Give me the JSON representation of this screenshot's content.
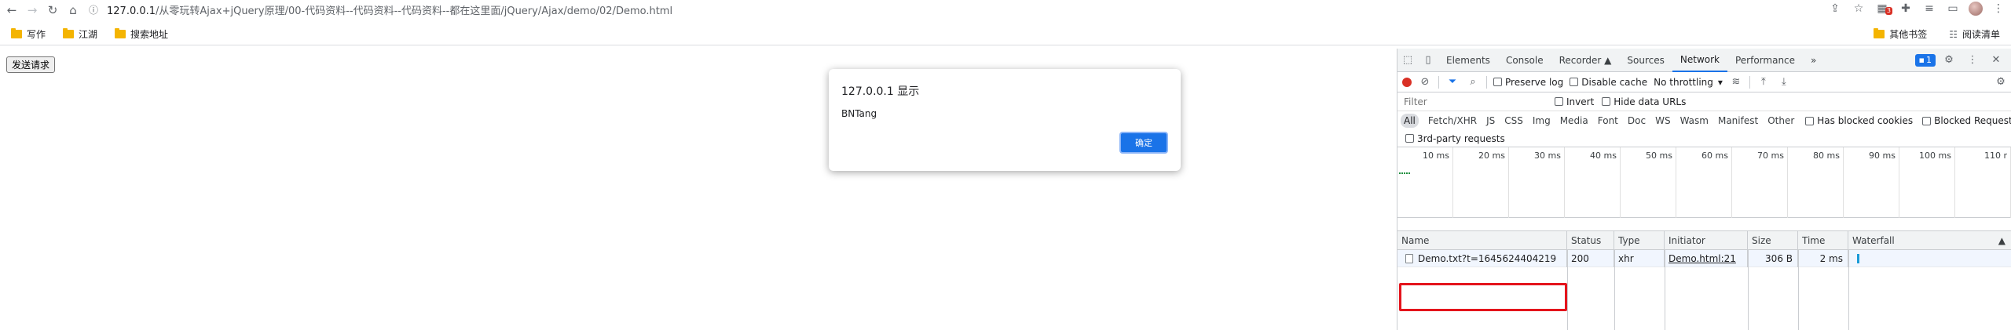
{
  "browser": {
    "url_host": "127.0.0.1",
    "url_path": "/从零玩转Ajax+jQuery原理/00-代码资料--代码资料--代码资料--都在这里面/jQuery/Ajax/demo/02/Demo.html",
    "extension_badge": "3",
    "bookmarks": [
      "写作",
      "江湖",
      "搜索地址"
    ],
    "bookmarks_right": [
      "其他书签",
      "阅读清单"
    ]
  },
  "page": {
    "send_button": "发送请求"
  },
  "alert": {
    "title": "127.0.0.1 显示",
    "message": "BNTang",
    "ok_label": "确定"
  },
  "devtools": {
    "tabs": [
      "Elements",
      "Console",
      "Recorder ▲",
      "Sources",
      "Network",
      "Performance"
    ],
    "active_tab": "Network",
    "more_tabs": "»",
    "issues_count": "1",
    "toolbar": {
      "preserve_log": "Preserve log",
      "disable_cache": "Disable cache",
      "throttling": "No throttling"
    },
    "filter": {
      "placeholder": "Filter",
      "invert": "Invert",
      "hide_data_urls": "Hide data URLs"
    },
    "types": [
      "All",
      "Fetch/XHR",
      "JS",
      "CSS",
      "Img",
      "Media",
      "Font",
      "Doc",
      "WS",
      "Wasm",
      "Manifest",
      "Other"
    ],
    "active_type": "All",
    "has_blocked_cookies": "Has blocked cookies",
    "blocked_requests": "Blocked Requests",
    "third_party": "3rd-party requests",
    "timeline_ticks": [
      "10 ms",
      "20 ms",
      "30 ms",
      "40 ms",
      "50 ms",
      "60 ms",
      "70 ms",
      "80 ms",
      "90 ms",
      "100 ms",
      "110 r"
    ],
    "columns": [
      "Name",
      "Status",
      "Type",
      "Initiator",
      "Size",
      "Time",
      "Waterfall"
    ],
    "rows": [
      {
        "name": "Demo.txt?t=1645624404219",
        "status": "200",
        "type": "xhr",
        "initiator": "Demo.html:21",
        "size": "306 B",
        "time": "2 ms"
      }
    ],
    "colors": {
      "accent": "#1a73e8",
      "record": "#d93025",
      "highlight_box": "#e4141c"
    }
  }
}
